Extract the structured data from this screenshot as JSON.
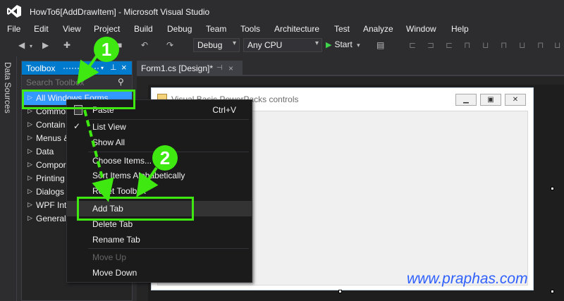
{
  "window": {
    "title": "HowTo6[AddDrawItem] - Microsoft Visual Studio"
  },
  "menu": [
    "File",
    "Edit",
    "View",
    "Project",
    "Build",
    "Debug",
    "Team",
    "Tools",
    "Architecture",
    "Test",
    "Analyze",
    "Window",
    "Help"
  ],
  "toolbar": {
    "config": "Debug",
    "platform": "Any CPU",
    "start_label": "Start"
  },
  "side_tab": {
    "label": "Data Sources"
  },
  "toolbox": {
    "title": "Toolbox",
    "search_placeholder": "Search Toolbox",
    "groups": [
      "All Windows Forms",
      "Common",
      "Contain",
      "Menus &",
      "Data",
      "Compor",
      "Printing",
      "Dialogs",
      "WPF Inte",
      "General"
    ]
  },
  "editor": {
    "tab_label": "Form1.cs [Design]*",
    "form_title": "Visual Basic PowerPacks controls"
  },
  "context_menu": {
    "items": [
      {
        "label": "Paste",
        "shortcut": "Ctrl+V"
      },
      {
        "label": "List View"
      },
      {
        "label": "Show All"
      },
      {
        "label": "Choose Items..."
      },
      {
        "label": "Sort Items Alphabetically"
      },
      {
        "label": "Reset Toolbox"
      },
      {
        "label": "Add Tab"
      },
      {
        "label": "Delete Tab"
      },
      {
        "label": "Rename Tab"
      },
      {
        "label": "Move Up"
      },
      {
        "label": "Move Down"
      }
    ]
  },
  "annotations": {
    "step1": "1",
    "step2": "2",
    "accent_color": "#3ee810"
  },
  "watermark": "www.praphas.com"
}
